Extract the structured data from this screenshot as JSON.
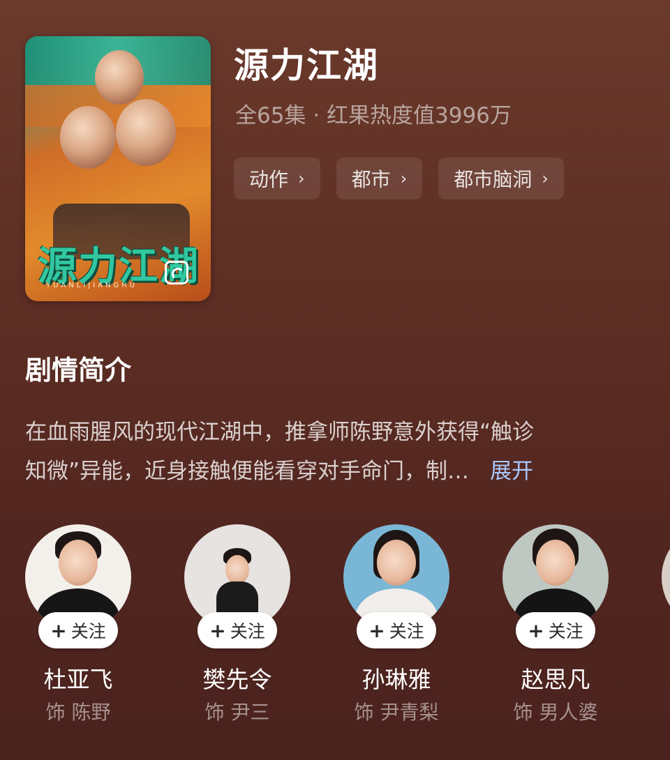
{
  "show": {
    "title": "源力江湖",
    "meta": "全65集 · 红果热度值3996万",
    "poster_title": "源力江湖",
    "poster_subtitle": "YUANLIJIANGHU",
    "tags": [
      {
        "label": "动作",
        "chevron": "›"
      },
      {
        "label": "都市",
        "chevron": "›"
      },
      {
        "label": "都市脑洞",
        "chevron": "›"
      }
    ]
  },
  "synopsis": {
    "heading": "剧情简介",
    "line1": "在血雨腥风的现代江湖中，推拿师陈野意外获得“触诊",
    "line2": "知微”异能，近身接触便能看穿对手命门，制…",
    "expand_label": "展开"
  },
  "cast": [
    {
      "actor": "杜亚飞",
      "role": "饰 陈野",
      "follow_label": "关注",
      "follow_plus": "+",
      "bg": "#f3efeb",
      "body": "#161616"
    },
    {
      "actor": "樊先令",
      "role": "饰 尹三",
      "follow_label": "关注",
      "follow_plus": "+",
      "bg": "#e6e3e1",
      "body": "#1b1b1b"
    },
    {
      "actor": "孙琳雅",
      "role": "饰 尹青梨",
      "follow_label": "关注",
      "follow_plus": "+",
      "bg": "#7ab7d6",
      "body": "#f1eeeb"
    },
    {
      "actor": "赵思凡",
      "role": "饰 男人婆",
      "follow_label": "关注",
      "follow_plus": "+",
      "bg": "#bfc7c2",
      "body": "#141414"
    }
  ],
  "colors": {
    "background_top": "#6b3a2c",
    "background_bottom": "#4a221d",
    "expand_link": "#a9c9ff",
    "poster_title": "#31c7a0"
  },
  "icons": {
    "tag_chevron": "chevron-right-icon",
    "poster_badge": "player-badge-icon",
    "follow_plus": "plus-icon"
  }
}
